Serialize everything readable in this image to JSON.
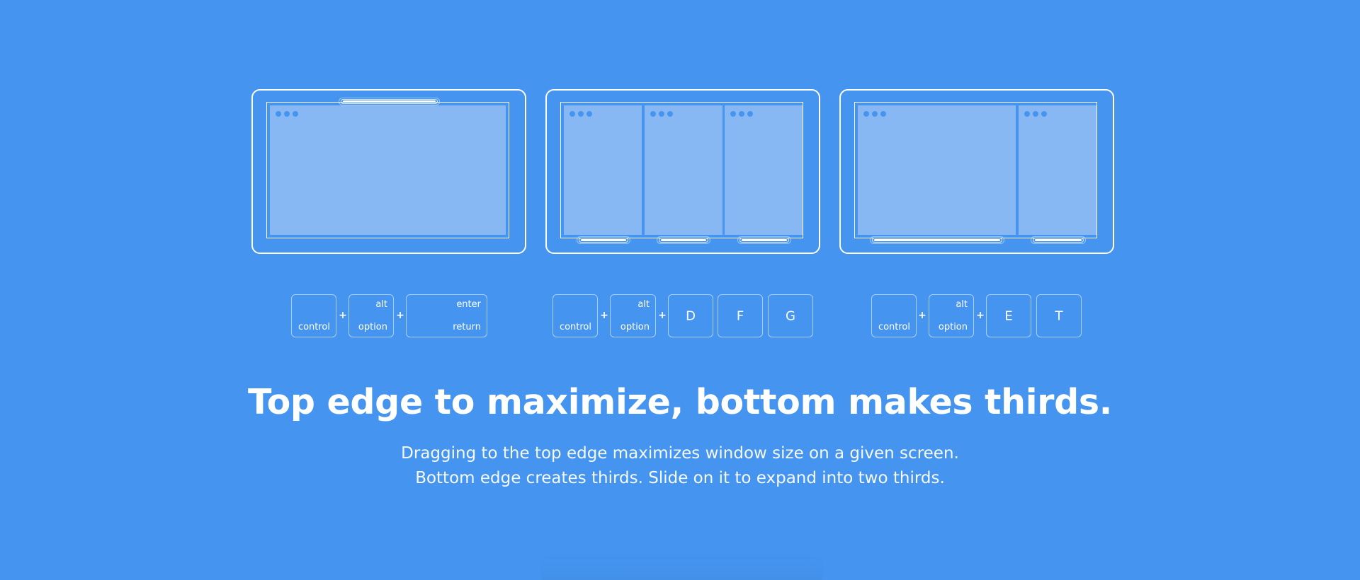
{
  "colors": {
    "background": "#4595F0",
    "window_fill": "#87B8F4",
    "line": "#FFFFFF"
  },
  "illustrations": [
    {
      "name": "maximize",
      "windows": [
        {
          "label": "full window",
          "dots": 3
        }
      ],
      "drag_handles": [
        {
          "edge": "top",
          "meaning": "maximize"
        }
      ]
    },
    {
      "name": "thirds",
      "windows": [
        {
          "label": "first third",
          "dots": 3
        },
        {
          "label": "center third",
          "dots": 3
        },
        {
          "label": "last third",
          "dots": 3
        }
      ],
      "drag_handles": [
        {
          "edge": "bottom",
          "meaning": "first third"
        },
        {
          "edge": "bottom",
          "meaning": "center third"
        },
        {
          "edge": "bottom",
          "meaning": "last third"
        }
      ]
    },
    {
      "name": "two-thirds",
      "windows": [
        {
          "label": "two thirds",
          "dots": 3
        },
        {
          "label": "one third",
          "dots": 3
        }
      ],
      "drag_handles": [
        {
          "edge": "bottom",
          "meaning": "two thirds"
        },
        {
          "edge": "bottom",
          "meaning": "last third"
        }
      ]
    }
  ],
  "shortcuts": [
    {
      "keys": [
        {
          "top": "",
          "bottom": "control"
        },
        {
          "top": "alt",
          "bottom": "option"
        },
        {
          "top": "enter",
          "bottom": "return"
        }
      ],
      "separator": "+"
    },
    {
      "keys": [
        {
          "top": "",
          "bottom": "control"
        },
        {
          "top": "alt",
          "bottom": "option"
        },
        {
          "center": "D"
        },
        {
          "center": "F"
        },
        {
          "center": "G"
        }
      ],
      "separator": "+"
    },
    {
      "keys": [
        {
          "top": "",
          "bottom": "control"
        },
        {
          "top": "alt",
          "bottom": "option"
        },
        {
          "center": "E"
        },
        {
          "center": "T"
        }
      ],
      "separator": "+"
    }
  ],
  "headline": "Top edge to maximize, bottom makes thirds.",
  "description": {
    "line1": "Dragging to the top edge maximizes window size on a given screen.",
    "line2": "Bottom edge creates thirds. Slide on it to expand into two thirds."
  }
}
